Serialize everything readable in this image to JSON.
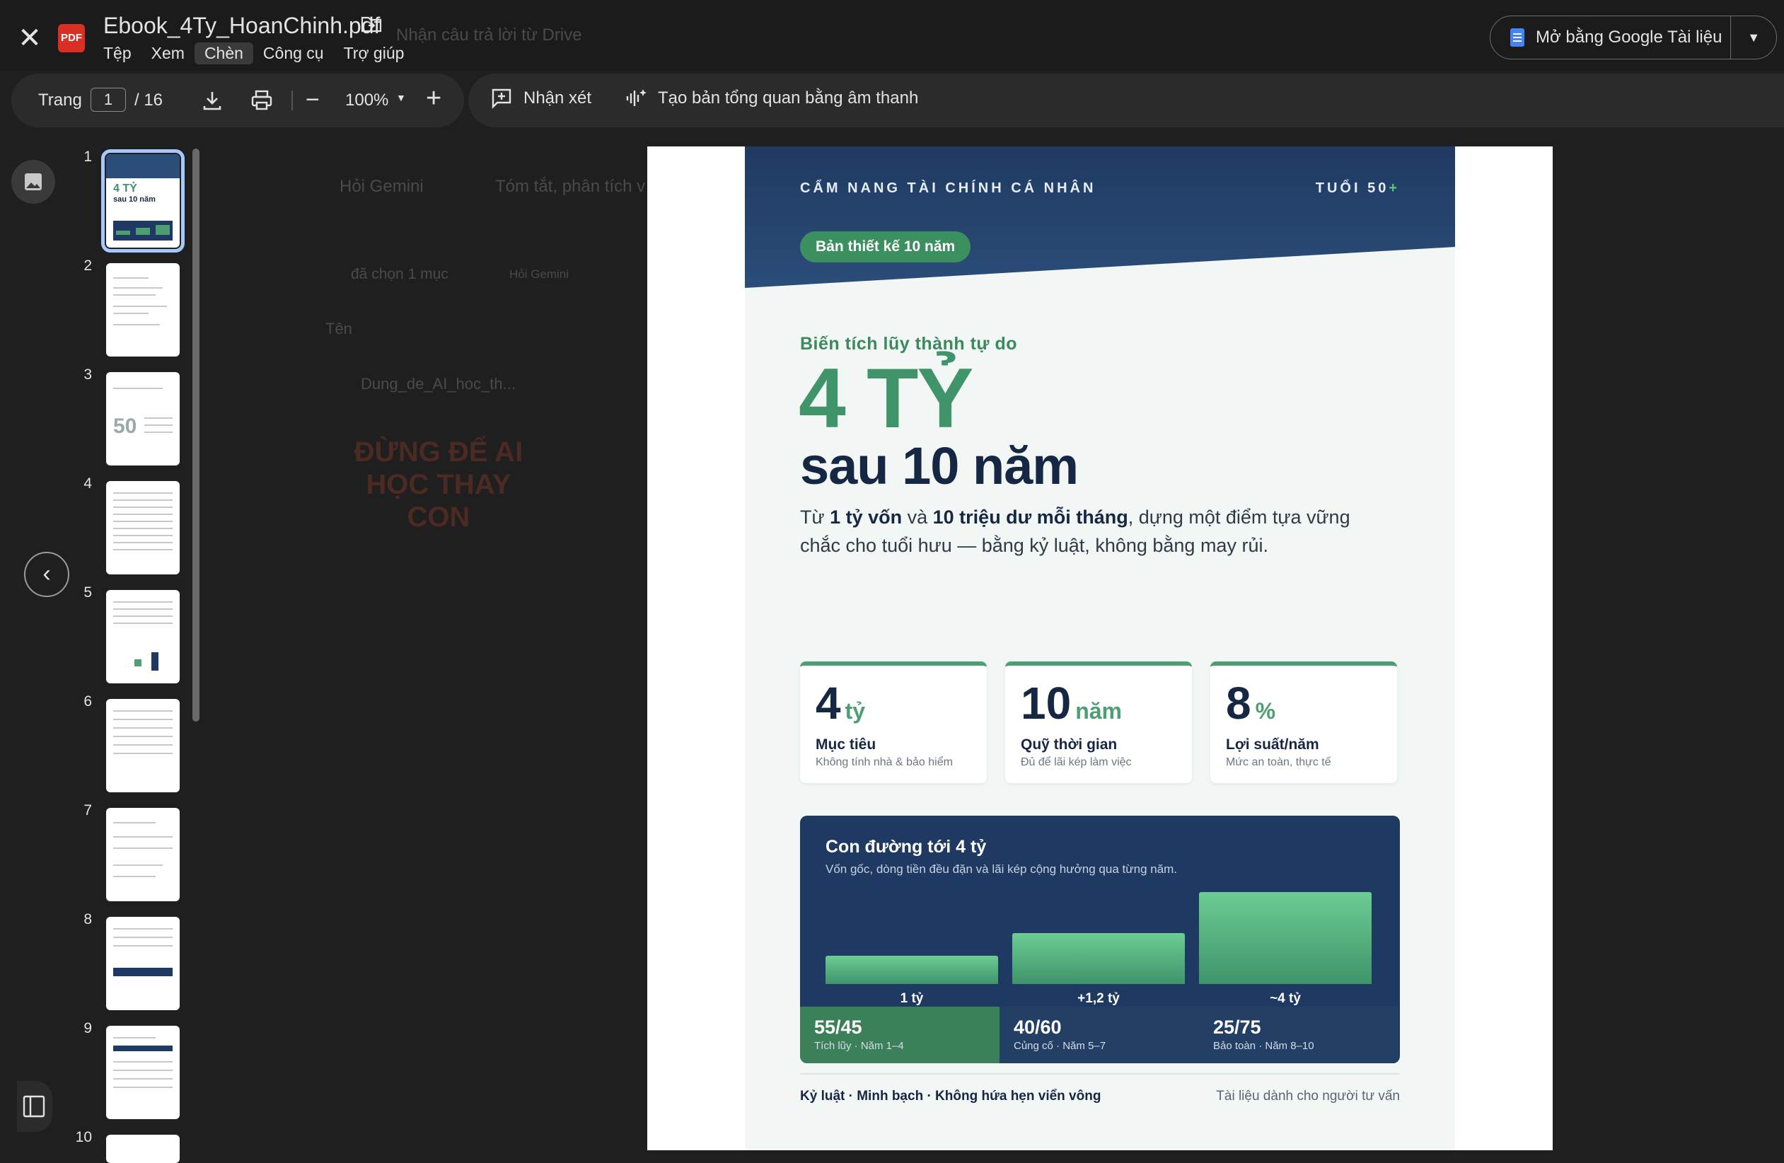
{
  "header": {
    "file_name": "Ebook_4Ty_HoanChinh.pdf",
    "pdf_badge": "PDF",
    "menu": [
      "Tệp",
      "Xem",
      "Chèn",
      "Công cụ",
      "Trợ giúp"
    ],
    "active_menu": "Chèn",
    "open_with": "Mở bằng Google Tài liệu"
  },
  "background": {
    "drive_title": "Nhận câu trả lời từ Drive",
    "ask_gemini": "Hỏi Gemini",
    "summary": "Tóm tắt, phân tích v",
    "selected": "đã chọn 1 mục",
    "ask_gemini_small": "Hỏi Gemini",
    "col_name": "Tên",
    "file_card": "Dung_de_AI_hoc_th...",
    "card_heading": "ĐỪNG ĐỂ AI\nHỌC THAY CON"
  },
  "toolbar": {
    "page_label": "Trang",
    "page_current": "1",
    "page_total": "/  16",
    "zoom": "100%",
    "comment": "Nhận xét",
    "audio": "Tạo bản tổng quan bằng âm thanh"
  },
  "thumbnails": [
    "1",
    "2",
    "3",
    "4",
    "5",
    "6",
    "7",
    "8",
    "9",
    "10"
  ],
  "page": {
    "kicker": "CẨM NANG TÀI CHÍNH CÁ NHÂN",
    "age": "TUỔI 50",
    "age_plus": "+",
    "pill": "Bản thiết kế 10 năm",
    "eyebrow": "Biến tích lũy thành tự do",
    "big": "4 TỶ",
    "sub": "sau 10 năm",
    "lead_1": "Từ ",
    "lead_b1": "1 tỷ vốn",
    "lead_2": " và ",
    "lead_b2": "10 triệu dư mỗi tháng",
    "lead_3": ", dựng một điểm tựa vững chắc cho tuổi hưu — bằng kỷ luật, không bằng may rủi.",
    "stats": [
      {
        "num": "4",
        "unit": "tỷ",
        "label": "Mục tiêu",
        "note": "Không tính nhà & bảo hiểm"
      },
      {
        "num": "10",
        "unit": "năm",
        "label": "Quỹ thời gian",
        "note": "Đủ để lãi kép làm việc"
      },
      {
        "num": "8",
        "unit": "%",
        "label": "Lợi suất/năm",
        "note": "Mức an toàn, thực tế"
      }
    ],
    "path_title": "Con đường tới 4 tỷ",
    "path_desc": "Vốn gốc, dòng tiền đều đặn và lãi kép cộng hưởng qua từng năm.",
    "footer_left": "Kỷ luật · Minh bạch · Không hứa hẹn viển vông",
    "footer_right": "Tài liệu dành cho người tư vấn"
  },
  "chart_data": {
    "type": "bar",
    "categories": [
      "1 tỷ",
      "+1,2 tỷ",
      "~4 tỷ"
    ],
    "values": [
      1,
      2.2,
      4
    ],
    "phases": [
      {
        "ratio": "55/45",
        "note": "Tích lũy · Năm 1–4"
      },
      {
        "ratio": "40/60",
        "note": "Củng cố · Năm 5–7"
      },
      {
        "ratio": "25/75",
        "note": "Bảo toàn · Năm 8–10"
      }
    ],
    "colors": {
      "bar": "#4e9e73",
      "card": "#1f3a62",
      "phase_active": "#3c8059",
      "phase": "#243f66"
    }
  }
}
